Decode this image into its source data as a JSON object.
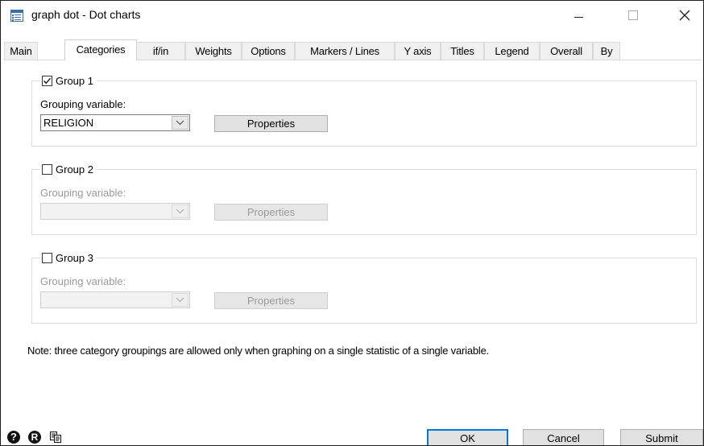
{
  "window": {
    "title": "graph dot - Dot charts",
    "app_icon": "dialog-icon",
    "controls": {
      "minimize": "minimize-icon",
      "maximize": "maximize-icon",
      "close": "close-icon"
    }
  },
  "tabs": [
    {
      "label": "Main",
      "active": false
    },
    {
      "label": "Categories",
      "active": true
    },
    {
      "label": "if/in",
      "active": false
    },
    {
      "label": "Weights",
      "active": false
    },
    {
      "label": "Options",
      "active": false
    },
    {
      "label": "Markers / Lines",
      "active": false
    },
    {
      "label": "Y axis",
      "active": false
    },
    {
      "label": "Titles",
      "active": false
    },
    {
      "label": "Legend",
      "active": false
    },
    {
      "label": "Overall",
      "active": false
    },
    {
      "label": "By",
      "active": false
    }
  ],
  "groups": [
    {
      "label": "Group 1",
      "checked": true,
      "grouping_label": "Grouping variable:",
      "variable": "RELIGION",
      "properties_label": "Properties",
      "enabled": true
    },
    {
      "label": "Group 2",
      "checked": false,
      "grouping_label": "Grouping variable:",
      "variable": "",
      "properties_label": "Properties",
      "enabled": false
    },
    {
      "label": "Group 3",
      "checked": false,
      "grouping_label": "Grouping variable:",
      "variable": "",
      "properties_label": "Properties",
      "enabled": false
    }
  ],
  "note": "Note: three category groupings are allowed only when graphing on a single statistic of a single variable.",
  "bottom": {
    "icons": [
      "help-icon",
      "reset-icon",
      "copy-command-icon"
    ],
    "help_glyph": "?",
    "reset_glyph": "R",
    "ok_label": "OK",
    "cancel_label": "Cancel",
    "submit_label": "Submit"
  },
  "colors": {
    "accent": "#0078d7",
    "checkbox_mark": "#1a1a1a",
    "disabled_text": "#9a9a9a"
  }
}
